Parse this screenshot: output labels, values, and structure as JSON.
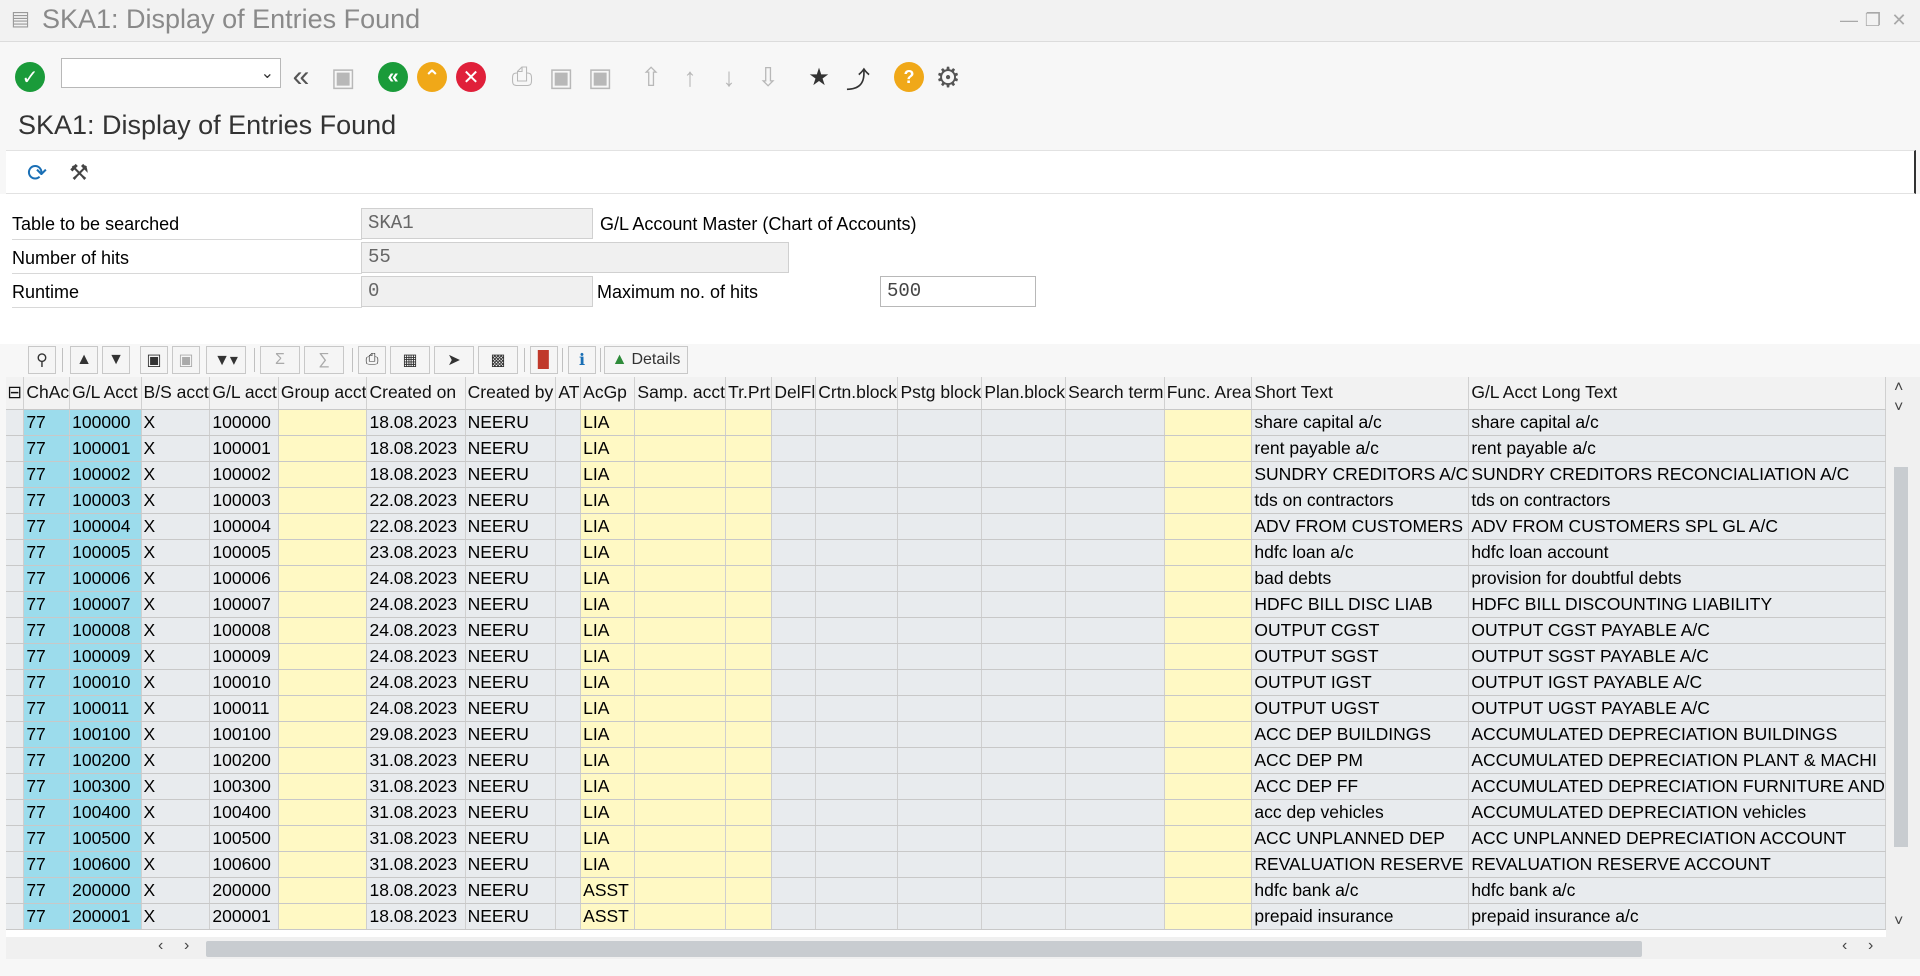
{
  "window": {
    "title": "SKA1: Display of Entries Found"
  },
  "toolbar": {
    "command_value": ""
  },
  "page_title": "SKA1: Display of Entries Found",
  "form": {
    "table_label": "Table to be searched",
    "table_value": "SKA1",
    "table_desc": "G/L Account Master (Chart of Accounts)",
    "hits_label": "Number of hits",
    "hits_value": "55",
    "runtime_label": "Runtime",
    "runtime_value": "0",
    "maxhits_label": "Maximum no. of hits",
    "maxhits_value": "500"
  },
  "grid_toolbar": {
    "details_label": "Details"
  },
  "columns": [
    "ChAc",
    "G/L Acct",
    "B/S acct",
    "G/L acct",
    "Group acct",
    "Created on",
    "Created by",
    "AT",
    "AcGp",
    "Samp. acct",
    "Tr.Prt",
    "DelFl",
    "Crtn.block",
    "Pstg block",
    "Plan.block",
    "Search term",
    "Func. Area",
    "Short Text",
    "G/L Acct Long Text"
  ],
  "rows": [
    [
      "77",
      "100000",
      "X",
      "100000",
      "",
      "18.08.2023",
      "NEERU",
      "",
      "LIA",
      "",
      "",
      "",
      "",
      "",
      "",
      "",
      "",
      "share capital a/c",
      "share capital a/c"
    ],
    [
      "77",
      "100001",
      "X",
      "100001",
      "",
      "18.08.2023",
      "NEERU",
      "",
      "LIA",
      "",
      "",
      "",
      "",
      "",
      "",
      "",
      "",
      "rent payable a/c",
      "rent payable a/c"
    ],
    [
      "77",
      "100002",
      "X",
      "100002",
      "",
      "18.08.2023",
      "NEERU",
      "",
      "LIA",
      "",
      "",
      "",
      "",
      "",
      "",
      "",
      "",
      "SUNDRY CREDITORS A/C",
      "SUNDRY CREDITORS RECONCIALIATION A/C"
    ],
    [
      "77",
      "100003",
      "X",
      "100003",
      "",
      "22.08.2023",
      "NEERU",
      "",
      "LIA",
      "",
      "",
      "",
      "",
      "",
      "",
      "",
      "",
      "tds on contractors",
      "tds on contractors"
    ],
    [
      "77",
      "100004",
      "X",
      "100004",
      "",
      "22.08.2023",
      "NEERU",
      "",
      "LIA",
      "",
      "",
      "",
      "",
      "",
      "",
      "",
      "",
      "ADV FROM CUSTOMERS",
      "ADV FROM CUSTOMERS SPL GL A/C"
    ],
    [
      "77",
      "100005",
      "X",
      "100005",
      "",
      "23.08.2023",
      "NEERU",
      "",
      "LIA",
      "",
      "",
      "",
      "",
      "",
      "",
      "",
      "",
      "hdfc loan a/c",
      "hdfc loan account"
    ],
    [
      "77",
      "100006",
      "X",
      "100006",
      "",
      "24.08.2023",
      "NEERU",
      "",
      "LIA",
      "",
      "",
      "",
      "",
      "",
      "",
      "",
      "",
      "bad debts",
      "provision for doubtful debts"
    ],
    [
      "77",
      "100007",
      "X",
      "100007",
      "",
      "24.08.2023",
      "NEERU",
      "",
      "LIA",
      "",
      "",
      "",
      "",
      "",
      "",
      "",
      "",
      "HDFC BILL DISC LIAB",
      "HDFC BILL DISCOUNTING LIABILITY"
    ],
    [
      "77",
      "100008",
      "X",
      "100008",
      "",
      "24.08.2023",
      "NEERU",
      "",
      "LIA",
      "",
      "",
      "",
      "",
      "",
      "",
      "",
      "",
      "OUTPUT CGST",
      "OUTPUT CGST PAYABLE A/C"
    ],
    [
      "77",
      "100009",
      "X",
      "100009",
      "",
      "24.08.2023",
      "NEERU",
      "",
      "LIA",
      "",
      "",
      "",
      "",
      "",
      "",
      "",
      "",
      "OUTPUT SGST",
      "OUTPUT SGST PAYABLE A/C"
    ],
    [
      "77",
      "100010",
      "X",
      "100010",
      "",
      "24.08.2023",
      "NEERU",
      "",
      "LIA",
      "",
      "",
      "",
      "",
      "",
      "",
      "",
      "",
      "OUTPUT IGST",
      "OUTPUT IGST PAYABLE A/C"
    ],
    [
      "77",
      "100011",
      "X",
      "100011",
      "",
      "24.08.2023",
      "NEERU",
      "",
      "LIA",
      "",
      "",
      "",
      "",
      "",
      "",
      "",
      "",
      "OUTPUT UGST",
      "OUTPUT UGST PAYABLE A/C"
    ],
    [
      "77",
      "100100",
      "X",
      "100100",
      "",
      "29.08.2023",
      "NEERU",
      "",
      "LIA",
      "",
      "",
      "",
      "",
      "",
      "",
      "",
      "",
      "ACC DEP BUILDINGS",
      "ACCUMULATED DEPRECIATION BUILDINGS"
    ],
    [
      "77",
      "100200",
      "X",
      "100200",
      "",
      "31.08.2023",
      "NEERU",
      "",
      "LIA",
      "",
      "",
      "",
      "",
      "",
      "",
      "",
      "",
      "ACC DEP PM",
      "ACCUMULATED DEPRECIATION PLANT & MACHI"
    ],
    [
      "77",
      "100300",
      "X",
      "100300",
      "",
      "31.08.2023",
      "NEERU",
      "",
      "LIA",
      "",
      "",
      "",
      "",
      "",
      "",
      "",
      "",
      "ACC DEP FF",
      "ACCUMULATED DEPRECIATION FURNITURE AND"
    ],
    [
      "77",
      "100400",
      "X",
      "100400",
      "",
      "31.08.2023",
      "NEERU",
      "",
      "LIA",
      "",
      "",
      "",
      "",
      "",
      "",
      "",
      "",
      "acc dep vehicles",
      "ACCUMULATED DEPRECIATION vehicles"
    ],
    [
      "77",
      "100500",
      "X",
      "100500",
      "",
      "31.08.2023",
      "NEERU",
      "",
      "LIA",
      "",
      "",
      "",
      "",
      "",
      "",
      "",
      "",
      "ACC UNPLANNED DEP",
      "ACC UNPLANNED DEPRECIATION ACCOUNT"
    ],
    [
      "77",
      "100600",
      "X",
      "100600",
      "",
      "31.08.2023",
      "NEERU",
      "",
      "LIA",
      "",
      "",
      "",
      "",
      "",
      "",
      "",
      "",
      "REVALUATION RESERVE",
      "REVALUATION RESERVE ACCOUNT"
    ],
    [
      "77",
      "200000",
      "X",
      "200000",
      "",
      "18.08.2023",
      "NEERU",
      "",
      "ASST",
      "",
      "",
      "",
      "",
      "",
      "",
      "",
      "",
      "hdfc bank a/c",
      "hdfc bank a/c"
    ],
    [
      "77",
      "200001",
      "X",
      "200001",
      "",
      "18.08.2023",
      "NEERU",
      "",
      "ASST",
      "",
      "",
      "",
      "",
      "",
      "",
      "",
      "",
      "prepaid insurance",
      "prepaid insurance a/c"
    ]
  ]
}
